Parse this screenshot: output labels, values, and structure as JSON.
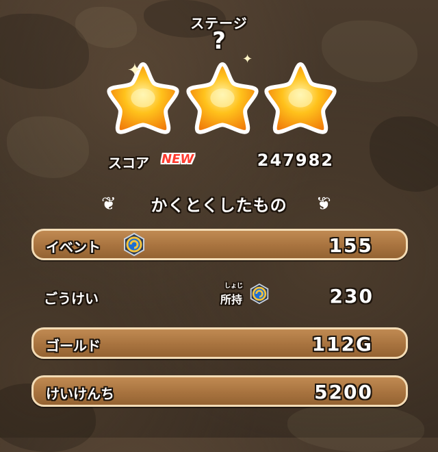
{
  "header": {
    "stage_label": "ステージ",
    "stage_number": "?"
  },
  "rating": {
    "stars_earned": 3,
    "stars_max": 3
  },
  "score": {
    "label": "スコア",
    "new_badge": "NEW",
    "value": "247982"
  },
  "rewards": {
    "title": "かくとくしたもの",
    "event": {
      "label": "イベント",
      "value": "155",
      "icon": "event-medal-icon"
    },
    "total": {
      "label": "ごうけい",
      "owned_label": "所持",
      "owned_furigana": "しょじ",
      "value": "230",
      "icon": "event-medal-icon"
    },
    "gold": {
      "label": "ゴールド",
      "value": "112G"
    },
    "exp": {
      "label": "けいけんち",
      "value": "5200"
    }
  },
  "colors": {
    "row_fill": "#a8733f",
    "row_border": "#f3dcb6",
    "star_gold": "#ffb21a",
    "new_badge": "#ff3b2f",
    "background": "#3e3226"
  }
}
